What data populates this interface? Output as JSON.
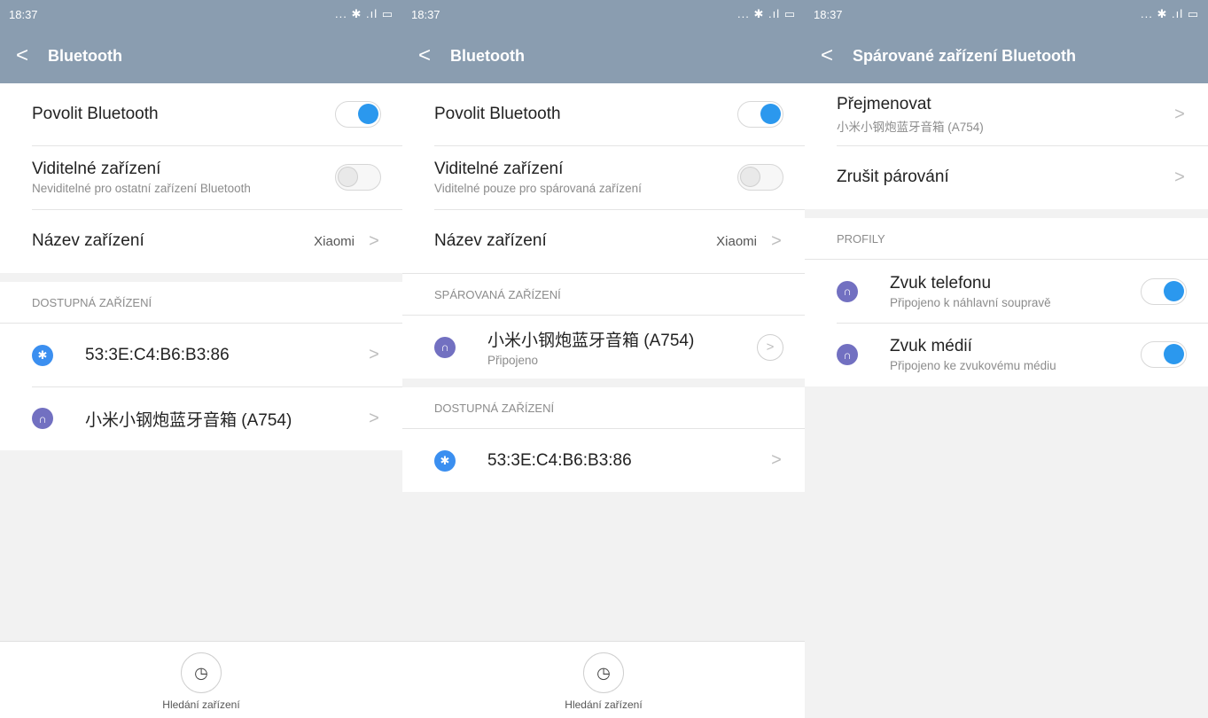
{
  "statusbar": {
    "time": "18:37",
    "icons": "... ✱ .ıl ▭"
  },
  "p1": {
    "title": "Bluetooth",
    "enable_label": "Povolit Bluetooth",
    "visible_label": "Viditelné zařízení",
    "visible_sub": "Neviditelné pro ostatní zařízení Bluetooth",
    "name_label": "Název zařízení",
    "name_value": "Xiaomi",
    "available_header": "DOSTUPNÁ ZAŘÍZENÍ",
    "devices": [
      {
        "name": "53:3E:C4:B6:B3:86",
        "type": "bluetooth-icon"
      },
      {
        "name": "小米小钢炮蓝牙音箱 (A754)",
        "type": "headphones-icon"
      }
    ],
    "scan_label": "Hledání zařízení"
  },
  "p2": {
    "title": "Bluetooth",
    "enable_label": "Povolit Bluetooth",
    "visible_label": "Viditelné zařízení",
    "visible_sub": "Viditelné pouze pro spárovaná zařízení",
    "name_label": "Název zařízení",
    "name_value": "Xiaomi",
    "paired_header": "SPÁROVANÁ ZAŘÍZENÍ",
    "paired_device": {
      "name": "小米小钢炮蓝牙音箱 (A754)",
      "status": "Připojeno"
    },
    "available_header": "DOSTUPNÁ ZAŘÍZENÍ",
    "available_device": "53:3E:C4:B6:B3:86",
    "scan_label": "Hledání zařízení"
  },
  "p3": {
    "title": "Spárované zařízení Bluetooth",
    "rename_label": "Přejmenovat",
    "rename_sub": "小米小钢炮蓝牙音箱 (A754)",
    "unpair_label": "Zrušit párování",
    "profiles_header": "PROFILY",
    "profiles": [
      {
        "name": "Zvuk telefonu",
        "sub": "Připojeno k náhlavní soupravě"
      },
      {
        "name": "Zvuk médií",
        "sub": "Připojeno ke zvukovému médiu"
      }
    ]
  },
  "colors": {
    "header_bg": "#8a9db0",
    "accent": "#2b98ee",
    "bt_icon": "#3b8ff0",
    "hp_icon": "#7270c1"
  }
}
